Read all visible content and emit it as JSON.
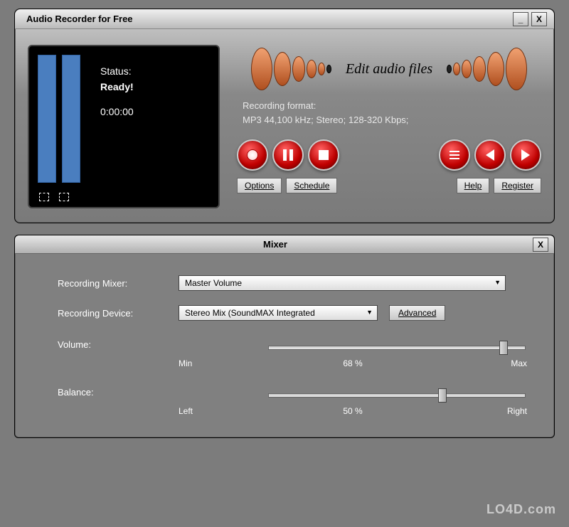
{
  "window": {
    "title": "Audio Recorder for Free"
  },
  "status": {
    "label": "Status:",
    "value": "Ready!",
    "time": "0:00:00"
  },
  "banner": {
    "text": "Edit audio files"
  },
  "format": {
    "label": "Recording format:",
    "value": "MP3 44,100 kHz; Stereo;  128-320 Kbps;"
  },
  "buttons": {
    "options": "Options",
    "schedule": "Schedule",
    "help": "Help",
    "register": "Register",
    "advanced": "Advanced"
  },
  "mixer": {
    "title": "Mixer",
    "recording_mixer_label": "Recording Mixer:",
    "recording_mixer_value": "Master Volume",
    "recording_device_label": "Recording Device:",
    "recording_device_value": "Stereo Mix (SoundMAX Integrated",
    "volume": {
      "label": "Volume:",
      "min": "Min",
      "max": "Max",
      "value_text": "68 %",
      "value_pct": 68
    },
    "balance": {
      "label": "Balance:",
      "left": "Left",
      "right": "Right",
      "value_text": "50 %",
      "value_pct": 50
    }
  },
  "watermark": "LO4D.com"
}
